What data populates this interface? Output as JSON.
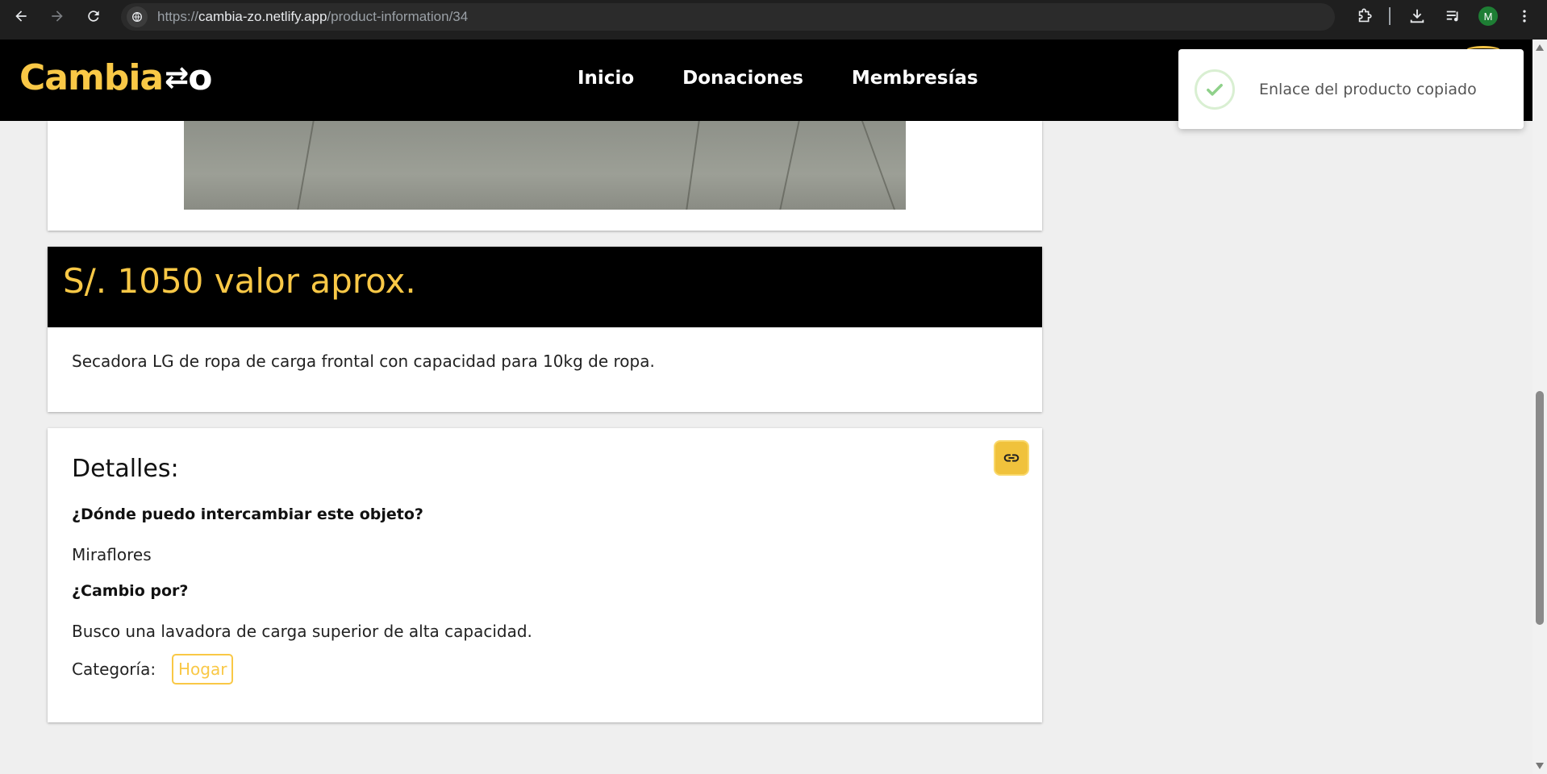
{
  "browser": {
    "url_prefix": "https://",
    "url_host": "cambia-zo.netlify.app",
    "url_path": "/product-information/34",
    "profile_initial": "M"
  },
  "header": {
    "logo_text": "Cambia",
    "logo_swap": "⇄",
    "logo_tail": "o",
    "nav": [
      "Inicio",
      "Donaciones",
      "Membresías"
    ]
  },
  "product": {
    "price": "S/. 1050 valor aprox.",
    "description": "Secadora LG de ropa de carga frontal con capacidad para 10kg de ropa."
  },
  "details": {
    "title": "Detalles:",
    "where_question": "¿Dónde puedo intercambiar este objeto?",
    "where_answer": "Miraflores",
    "exchange_question": "¿Cambio por?",
    "exchange_answer": "Busco una lavadora de carga superior de alta capacidad.",
    "category_label": "Categoría:",
    "category_value": "Hogar"
  },
  "toast": {
    "message": "Enlace del producto copiado"
  },
  "colors": {
    "brand_yellow": "#f9c846",
    "header_bg": "#000000",
    "page_bg": "#efefef"
  }
}
